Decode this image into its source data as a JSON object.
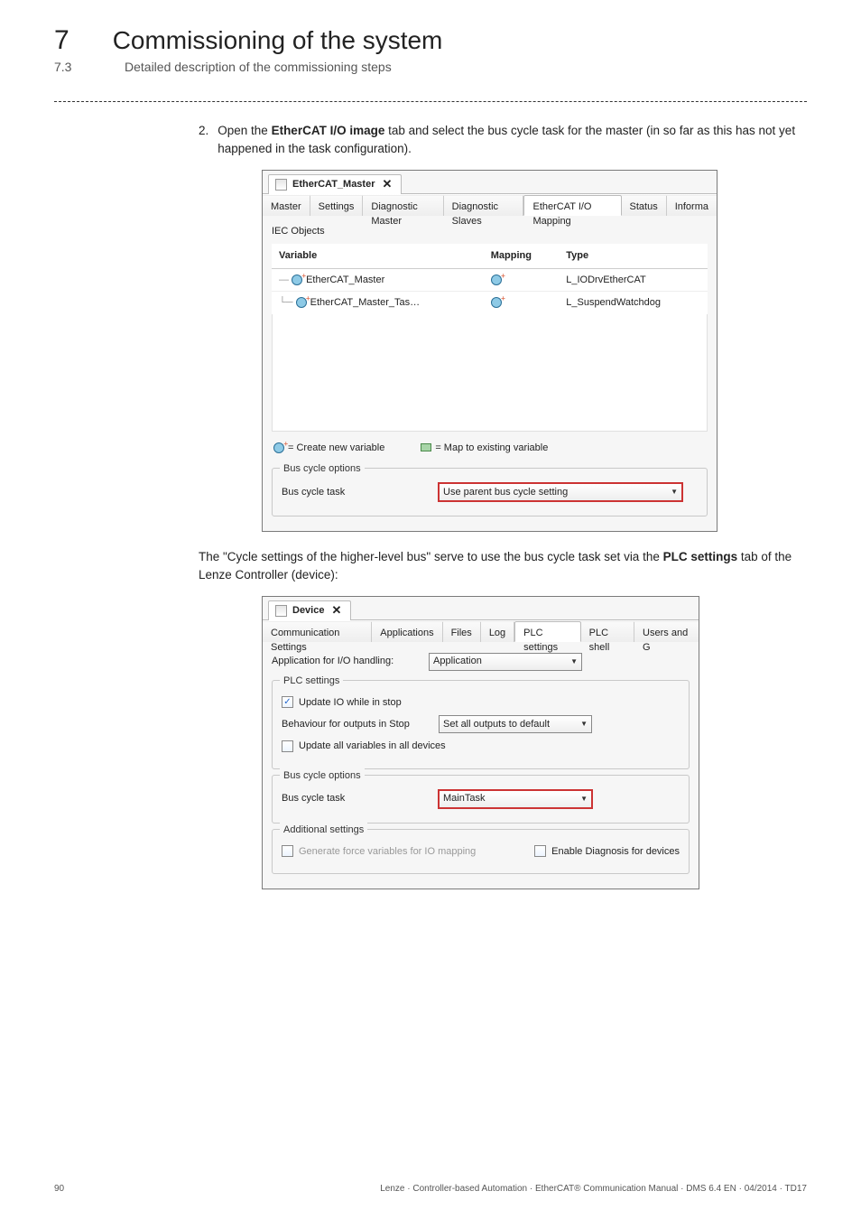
{
  "header": {
    "ch_num": "7",
    "ch_title": "Commissioning of the system",
    "sec_num": "7.3",
    "sec_title": "Detailed description of the commissioning steps"
  },
  "step": {
    "num": "2.",
    "text_before": "Open the ",
    "bold1": "EtherCAT I/O image",
    "text_after": " tab and select the bus cycle task for the master (in so far as this has not yet happened in the task configuration)."
  },
  "shot1": {
    "window_tab": "EtherCAT_Master",
    "tabs": [
      "Master",
      "Settings",
      "Diagnostic Master",
      "Diagnostic Slaves",
      "EtherCAT I/O Mapping",
      "Status",
      "Informa"
    ],
    "active_tab": 4,
    "iec_label": "IEC Objects",
    "columns": [
      "Variable",
      "Mapping",
      "Type"
    ],
    "rows": [
      {
        "variable": "EtherCAT_Master",
        "type": "L_IODrvEtherCAT"
      },
      {
        "variable": "EtherCAT_Master_Tas…",
        "type": "L_SuspendWatchdog"
      }
    ],
    "legend_new": "= Create new variable",
    "legend_map": "= Map to existing variable",
    "bus_cycle_section": "Bus cycle options",
    "bus_cycle_label": "Bus cycle task",
    "bus_cycle_value": "Use parent bus cycle setting"
  },
  "para1": {
    "t1": "The \"Cycle settings of the higher-level bus\" serve to use the bus cycle task set via the ",
    "b1": "PLC settings",
    "t2": " tab of the Lenze Controller (device):"
  },
  "shot2": {
    "window_tab": "Device",
    "tabs": [
      "Communication Settings",
      "Applications",
      "Files",
      "Log",
      "PLC settings",
      "PLC shell",
      "Users and G"
    ],
    "active_tab": 4,
    "app_io_label": "Application for I/O handling:",
    "app_io_value": "Application",
    "plc_section": "PLC settings",
    "cb_update_io": "Update IO while in stop",
    "beh_label": "Behaviour for outputs in Stop",
    "beh_value": "Set all outputs to default",
    "cb_update_all": "Update all variables in all devices",
    "bus_cycle_section": "Bus cycle options",
    "bus_cycle_label": "Bus cycle task",
    "bus_cycle_value": "MainTask",
    "add_section": "Additional settings",
    "cb_force": "Generate force variables for IO mapping",
    "cb_diag": "Enable Diagnosis for devices"
  },
  "footer": {
    "page": "90",
    "tag": "Lenze · Controller-based Automation · EtherCAT® Communication Manual · DMS 6.4 EN · 04/2014 · TD17"
  }
}
